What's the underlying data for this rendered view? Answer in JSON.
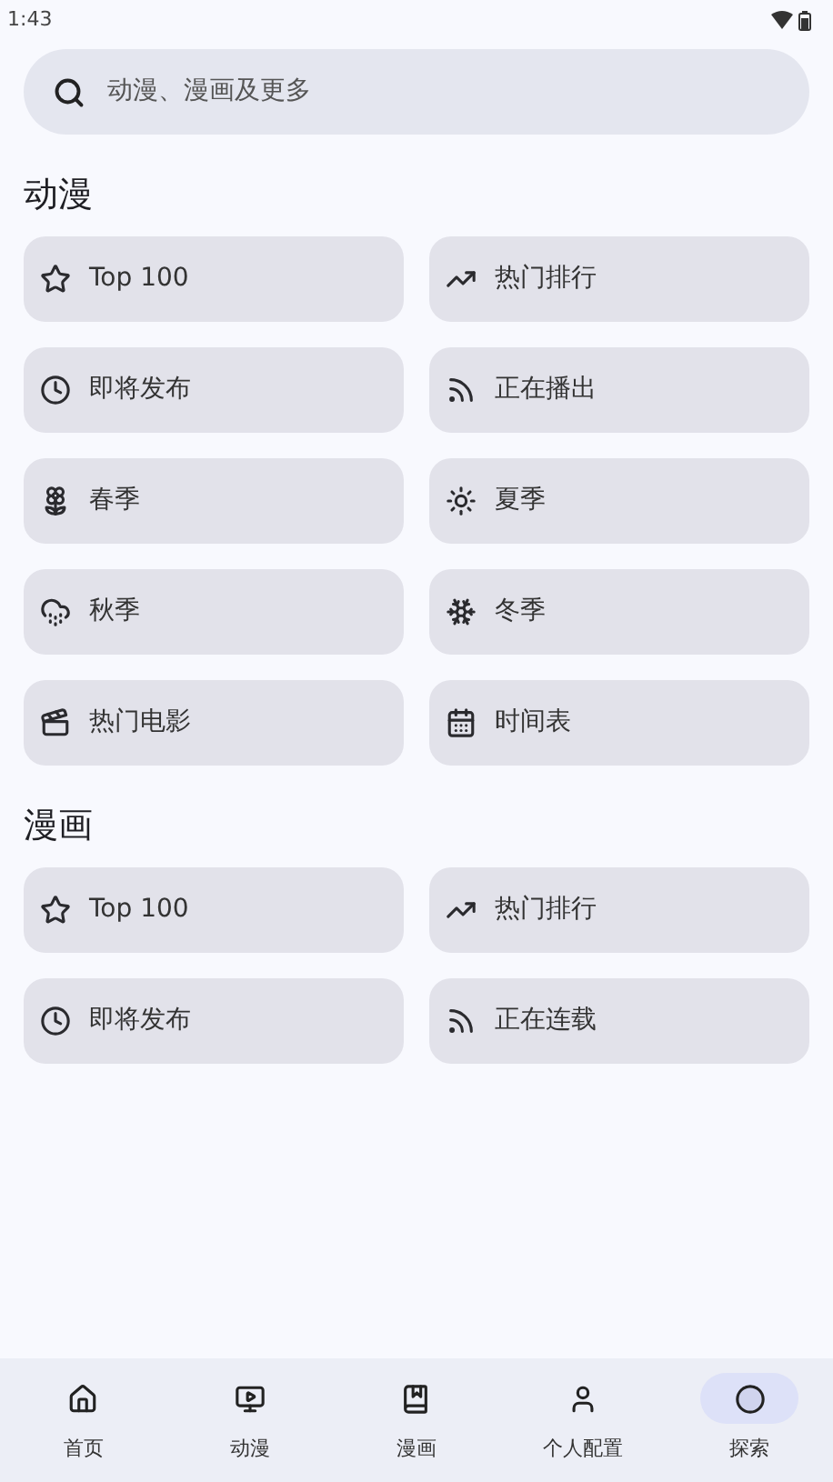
{
  "status_bar": {
    "time": "1:43"
  },
  "search": {
    "placeholder": "动漫、漫画及更多"
  },
  "sections": [
    {
      "title": "动漫",
      "items": [
        {
          "label": "Top 100"
        },
        {
          "label": "热门排行"
        },
        {
          "label": "即将发布"
        },
        {
          "label": "正在播出"
        },
        {
          "label": "春季"
        },
        {
          "label": "夏季"
        },
        {
          "label": "秋季"
        },
        {
          "label": "冬季"
        },
        {
          "label": "热门电影"
        },
        {
          "label": "时间表"
        }
      ]
    },
    {
      "title": "漫画",
      "items": [
        {
          "label": "Top 100"
        },
        {
          "label": "热门排行"
        },
        {
          "label": "即将发布"
        },
        {
          "label": "正在连载"
        }
      ]
    }
  ],
  "bottom_nav": [
    {
      "label": "首页",
      "selected": false
    },
    {
      "label": "动漫",
      "selected": false
    },
    {
      "label": "漫画",
      "selected": false
    },
    {
      "label": "个人配置",
      "selected": false
    },
    {
      "label": "探索",
      "selected": true
    }
  ]
}
